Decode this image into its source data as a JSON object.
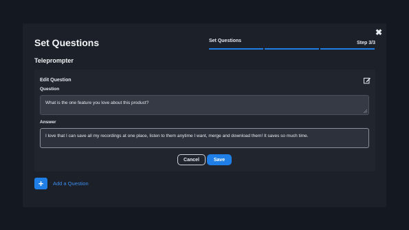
{
  "modal": {
    "title": "Set Questions",
    "close_icon": "close-icon",
    "steps_label": "Set Questions",
    "step_count": "Step 3/3",
    "progress_fraction": 1.0,
    "accent_color": "#1f7fe6",
    "subtitle": "Teleprompter"
  },
  "edit_card": {
    "title": "Edit Question",
    "edit_icon": "edit-icon",
    "question_label": "Question",
    "question_value": "What is the one feature you love about this product?",
    "answer_label": "Answer",
    "answer_value": "I love that I can save all my recordings at one place, listen to them anytime I want, merge and download them! It saves so much time.",
    "cancel_label": "Cancel",
    "save_label": "Save"
  },
  "add_question": {
    "icon": "plus-icon",
    "label": "Add a Question"
  }
}
